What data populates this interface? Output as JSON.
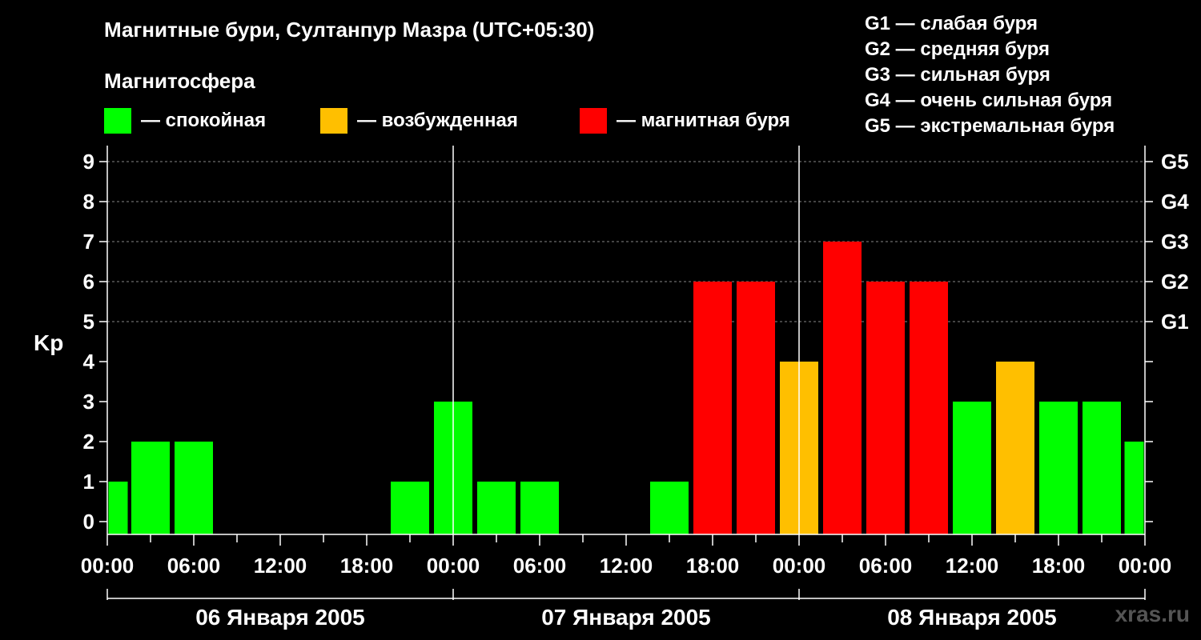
{
  "title": "Магнитные бури, Султанпур Мазра (UTC+05:30)",
  "subtitle": "Магнитосфера",
  "legend": [
    {
      "label": "— спокойная",
      "color": "#00ff00"
    },
    {
      "label": "— возбужденная",
      "color": "#ffbf00"
    },
    {
      "label": "— магнитная буря",
      "color": "#ff0000"
    }
  ],
  "g_legend": [
    "G1 — слабая буря",
    "G2 — средняя буря",
    "G3 — сильная буря",
    "G4 — очень сильная буря",
    "G5 — экстремальная буря"
  ],
  "watermark": "xras.ru",
  "colors": {
    "quiet": "#00ff00",
    "unsettled": "#ffbf00",
    "storm": "#ff0000",
    "background": "#000000",
    "grid": "#888888"
  },
  "chart_data": {
    "type": "bar",
    "ylabel": "Kp",
    "ylim": [
      0,
      9
    ],
    "yticks": [
      0,
      1,
      2,
      3,
      4,
      5,
      6,
      7,
      8,
      9
    ],
    "right_ticks": [
      {
        "level": 5,
        "label": "G1"
      },
      {
        "level": 6,
        "label": "G2"
      },
      {
        "level": 7,
        "label": "G3"
      },
      {
        "level": 8,
        "label": "G4"
      },
      {
        "level": 9,
        "label": "G5"
      }
    ],
    "grid": "dashed horizontal at G levels",
    "x_range_hours": [
      0,
      72
    ],
    "x_tick_labels": [
      "00:00",
      "06:00",
      "12:00",
      "18:00",
      "00:00",
      "06:00",
      "12:00",
      "18:00",
      "00:00",
      "06:00",
      "12:00",
      "18:00",
      "00:00"
    ],
    "days": [
      "06 Января 2005",
      "07 Января 2005",
      "08 Января 2005"
    ],
    "bars": [
      {
        "start": 0,
        "end": 1.5,
        "value": 1,
        "level": "quiet"
      },
      {
        "start": 1.5,
        "end": 4.5,
        "value": 2,
        "level": "quiet"
      },
      {
        "start": 4.5,
        "end": 7.5,
        "value": 2,
        "level": "quiet"
      },
      {
        "start": 7.5,
        "end": 10.5,
        "value": 0,
        "level": "quiet"
      },
      {
        "start": 10.5,
        "end": 13.5,
        "value": 0,
        "level": "quiet"
      },
      {
        "start": 13.5,
        "end": 16.5,
        "value": 0,
        "level": "quiet"
      },
      {
        "start": 16.5,
        "end": 19.5,
        "value": 0,
        "level": "quiet"
      },
      {
        "start": 19.5,
        "end": 22.5,
        "value": 1,
        "level": "quiet"
      },
      {
        "start": 22.5,
        "end": 25.5,
        "value": 3,
        "level": "quiet"
      },
      {
        "start": 25.5,
        "end": 28.5,
        "value": 1,
        "level": "quiet"
      },
      {
        "start": 28.5,
        "end": 31.5,
        "value": 1,
        "level": "quiet"
      },
      {
        "start": 31.5,
        "end": 34.5,
        "value": 0,
        "level": "quiet"
      },
      {
        "start": 34.5,
        "end": 37.5,
        "value": 0,
        "level": "quiet"
      },
      {
        "start": 37.5,
        "end": 40.5,
        "value": 1,
        "level": "quiet"
      },
      {
        "start": 40.5,
        "end": 43.5,
        "value": 6,
        "level": "storm"
      },
      {
        "start": 43.5,
        "end": 46.5,
        "value": 6,
        "level": "storm"
      },
      {
        "start": 46.5,
        "end": 49.5,
        "value": 4,
        "level": "unsettled"
      },
      {
        "start": 49.5,
        "end": 52.5,
        "value": 7,
        "level": "storm"
      },
      {
        "start": 52.5,
        "end": 55.5,
        "value": 6,
        "level": "storm"
      },
      {
        "start": 55.5,
        "end": 58.5,
        "value": 6,
        "level": "storm"
      },
      {
        "start": 58.5,
        "end": 61.5,
        "value": 3,
        "level": "quiet"
      },
      {
        "start": 61.5,
        "end": 64.5,
        "value": 4,
        "level": "unsettled"
      },
      {
        "start": 64.5,
        "end": 67.5,
        "value": 3,
        "level": "quiet"
      },
      {
        "start": 67.5,
        "end": 70.5,
        "value": 3,
        "level": "quiet"
      },
      {
        "start": 70.5,
        "end": 72,
        "value": 2,
        "level": "quiet"
      }
    ]
  }
}
